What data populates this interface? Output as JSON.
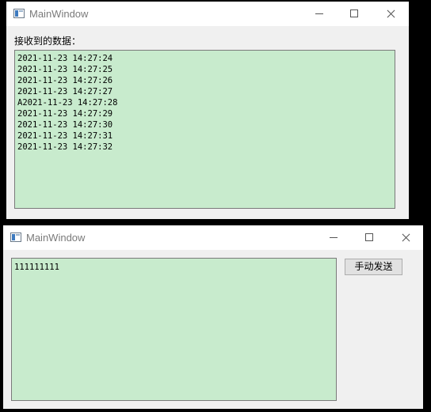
{
  "window1": {
    "title": "MainWindow",
    "received_label": "接收到的数据：",
    "lines": [
      "2021-11-23 14:27:24",
      "2021-11-23 14:27:25",
      "2021-11-23 14:27:26",
      "2021-11-23 14:27:27",
      "A2021-11-23 14:27:28",
      "2021-11-23 14:27:29",
      "2021-11-23 14:27:30",
      "2021-11-23 14:27:31",
      "2021-11-23 14:27:32"
    ],
    "textbox_color": "#c8ebcd"
  },
  "window2": {
    "title": "MainWindow",
    "input_text": "111111111",
    "send_button_label": "手动发送",
    "textbox_color": "#c8ebcd"
  }
}
